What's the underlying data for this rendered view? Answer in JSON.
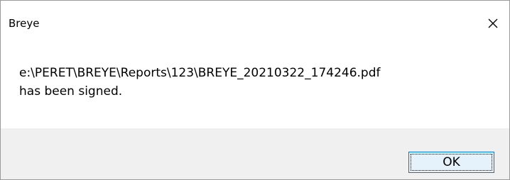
{
  "window": {
    "title": "Breye",
    "close_icon": "close-icon"
  },
  "message": {
    "line1": "e:\\PERET\\BREYE\\Reports\\123\\BREYE_20210322_174246.pdf",
    "line2": "has been signed."
  },
  "buttons": {
    "ok_label": "OK"
  },
  "colors": {
    "footer_bg": "#f0f0f0",
    "button_border": "#0078d7",
    "button_bg": "#e5f1fb"
  }
}
